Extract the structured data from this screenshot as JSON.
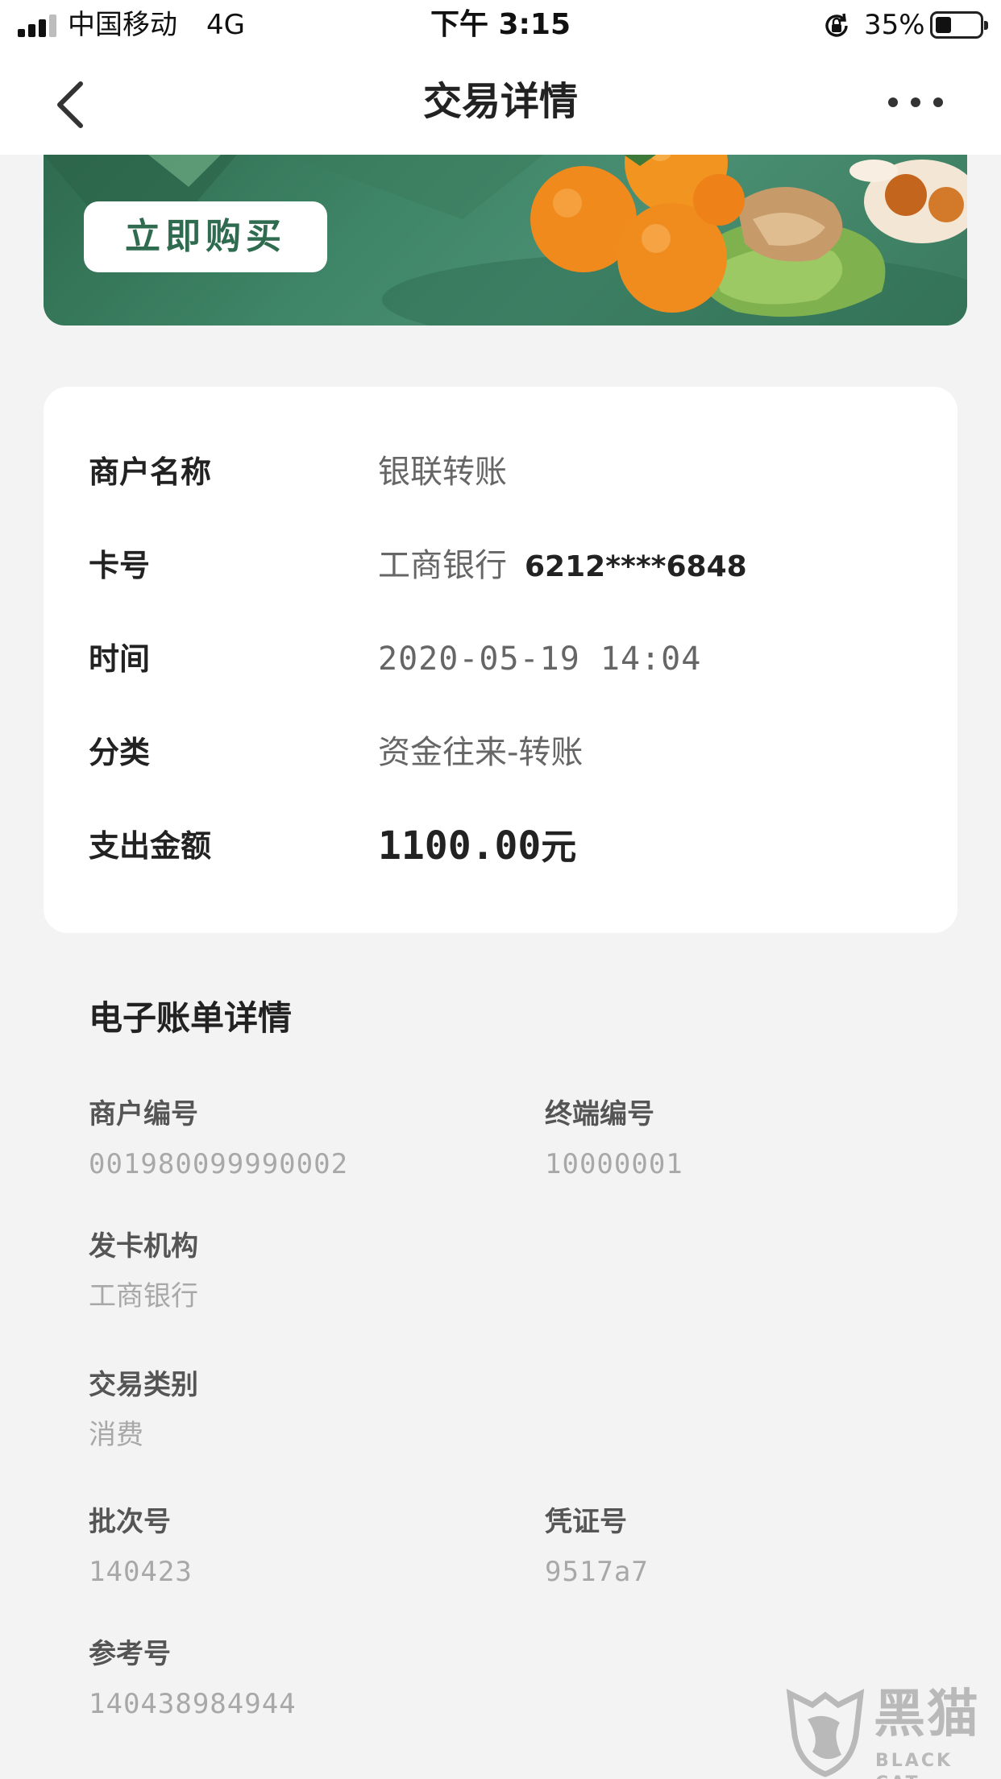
{
  "status_bar": {
    "carrier": "中国移动",
    "network": "4G",
    "time": "下午 3:15",
    "battery_percent": "35%",
    "battery_level": 0.35,
    "icons": [
      "signal-icon",
      "rotation-lock-icon",
      "battery-icon"
    ]
  },
  "nav": {
    "title": "交易详情",
    "back_icon": "chevron-left-icon",
    "more_icon": "more-dots-icon"
  },
  "banner": {
    "button_label": "立即购买",
    "colors": {
      "background": "#3e8466",
      "button_text": "#2f6b4f"
    }
  },
  "details": [
    {
      "label": "商户名称",
      "value": "银联转账"
    },
    {
      "label": "卡号",
      "value": "工商银行",
      "card_number": "6212****6848"
    },
    {
      "label": "时间",
      "value": "2020-05-19 14:04"
    },
    {
      "label": "分类",
      "value": "资金往来-转账"
    },
    {
      "label": "支出金额",
      "amount": "1100.00",
      "unit": "元"
    }
  ],
  "ebill": {
    "title": "电子账单详情",
    "fields": [
      {
        "label": "商户编号",
        "value": "001980099990002"
      },
      {
        "label": "终端编号",
        "value": "10000001"
      },
      {
        "label": "发卡机构",
        "value": "工商银行"
      },
      {
        "label": "交易类别",
        "value": "消费"
      },
      {
        "label": "批次号",
        "value": "140423"
      },
      {
        "label": "凭证号",
        "value": "9517a7"
      },
      {
        "label": "参考号",
        "value": "140438984944"
      }
    ]
  },
  "watermark": {
    "text": "黑猫",
    "sub": "BLACK CAT"
  }
}
